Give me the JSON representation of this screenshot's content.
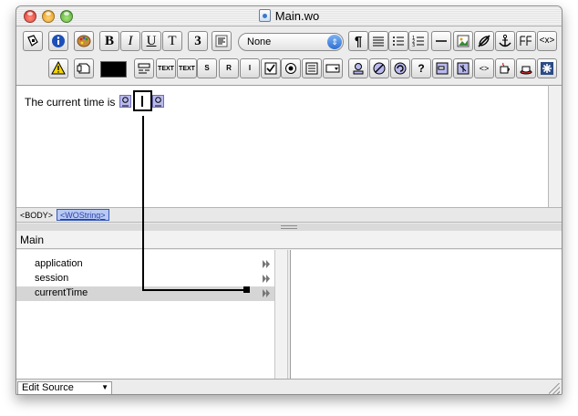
{
  "window": {
    "title": "Main.wo"
  },
  "toolbar_row1": {
    "items": [
      {
        "name": "inspector-icon"
      },
      {
        "name": "info-icon"
      },
      {
        "name": "palette-icon"
      },
      {
        "name": "bold-button",
        "label": "B"
      },
      {
        "name": "italic-button",
        "label": "I"
      },
      {
        "name": "underline-button",
        "label": "U"
      },
      {
        "name": "teletype-button",
        "label": "T"
      },
      {
        "name": "font-size-button",
        "label": "3"
      },
      {
        "name": "align-icon"
      },
      {
        "name": "paragraph-icon",
        "label": "¶"
      },
      {
        "name": "hr-list-icon"
      },
      {
        "name": "bullet-list-icon"
      },
      {
        "name": "numbered-list-icon"
      },
      {
        "name": "horizontal-rule-icon"
      },
      {
        "name": "image-icon"
      },
      {
        "name": "no-link-icon"
      },
      {
        "name": "anchor-icon"
      },
      {
        "name": "table-icon"
      },
      {
        "name": "code-icon",
        "label": "<x>"
      }
    ],
    "style_select": {
      "value": "None"
    }
  },
  "toolbar_row2": {
    "items": [
      {
        "name": "warning-icon"
      },
      {
        "name": "component-icon"
      },
      {
        "name": "text-field-icon"
      },
      {
        "name": "text-area-icon"
      },
      {
        "name": "text-icon"
      },
      {
        "name": "submit-button-icon",
        "label": "S"
      },
      {
        "name": "reset-button-icon",
        "label": "R"
      },
      {
        "name": "image-button-icon",
        "label": "I"
      },
      {
        "name": "checkbox-icon"
      },
      {
        "name": "radio-icon"
      },
      {
        "name": "browser-icon"
      },
      {
        "name": "popup-icon"
      },
      {
        "name": "wo-string-icon"
      },
      {
        "name": "hyperlink-icon"
      },
      {
        "name": "repetition-icon"
      },
      {
        "name": "conditional-icon"
      },
      {
        "name": "form-icon"
      },
      {
        "name": "custom-icon"
      },
      {
        "name": "generic-element-icon"
      },
      {
        "name": "java-icon"
      },
      {
        "name": "star-icon"
      }
    ],
    "color_swatch": "#000000"
  },
  "editor": {
    "text": "The current time is"
  },
  "pathbar": {
    "body": "<BODY>",
    "tag": "<WOString>"
  },
  "object_browser": {
    "title": "Main",
    "rows": [
      {
        "label": "application",
        "selected": false
      },
      {
        "label": "session",
        "selected": false
      },
      {
        "label": "currentTime",
        "selected": true
      }
    ]
  },
  "statusbar": {
    "mode": "Edit Source"
  }
}
